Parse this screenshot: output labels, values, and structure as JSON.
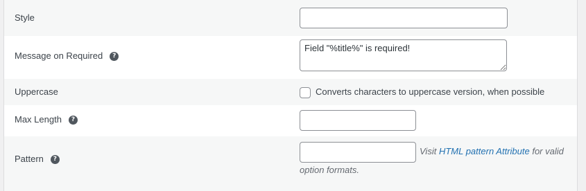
{
  "rows": {
    "style": {
      "label": "Style",
      "value": ""
    },
    "message_required": {
      "label": "Message on Required",
      "value": "Field \"%title%\" is required!"
    },
    "uppercase": {
      "label": "Uppercase",
      "checkbox_label": "Converts characters to uppercase version, when possible",
      "checked": false
    },
    "max_length": {
      "label": "Max Length",
      "value": ""
    },
    "pattern": {
      "label": "Pattern",
      "value": "",
      "desc_prefix": "Visit ",
      "desc_link": "HTML pattern Attribute",
      "desc_suffix": " for valid option formats."
    }
  },
  "help_icon_glyph": "?"
}
